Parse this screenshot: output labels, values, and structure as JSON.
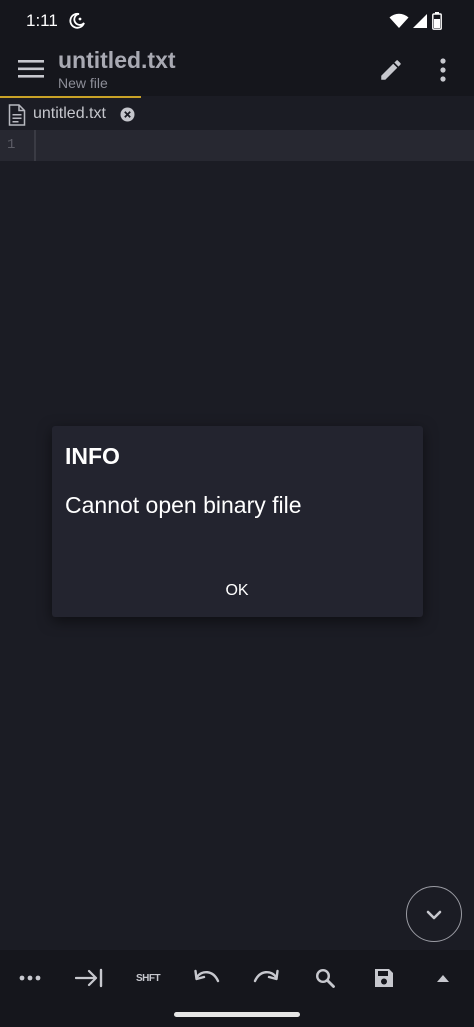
{
  "status_bar": {
    "time": "1:11"
  },
  "toolbar": {
    "title": "untitled.txt",
    "subtitle": "New file"
  },
  "tabs": [
    {
      "label": "untitled.txt"
    }
  ],
  "editor": {
    "line_numbers": [
      "1"
    ]
  },
  "dialog": {
    "title": "INFO",
    "message": "Cannot open binary file",
    "ok_label": "OK"
  },
  "bottom_bar": {
    "shift_label": "SHFT"
  },
  "colors": {
    "background": "#1b1c24",
    "bar": "#15161c",
    "dialog": "#23242f",
    "tab_accent": "#c9a227",
    "icon": "#c7c8ce"
  }
}
